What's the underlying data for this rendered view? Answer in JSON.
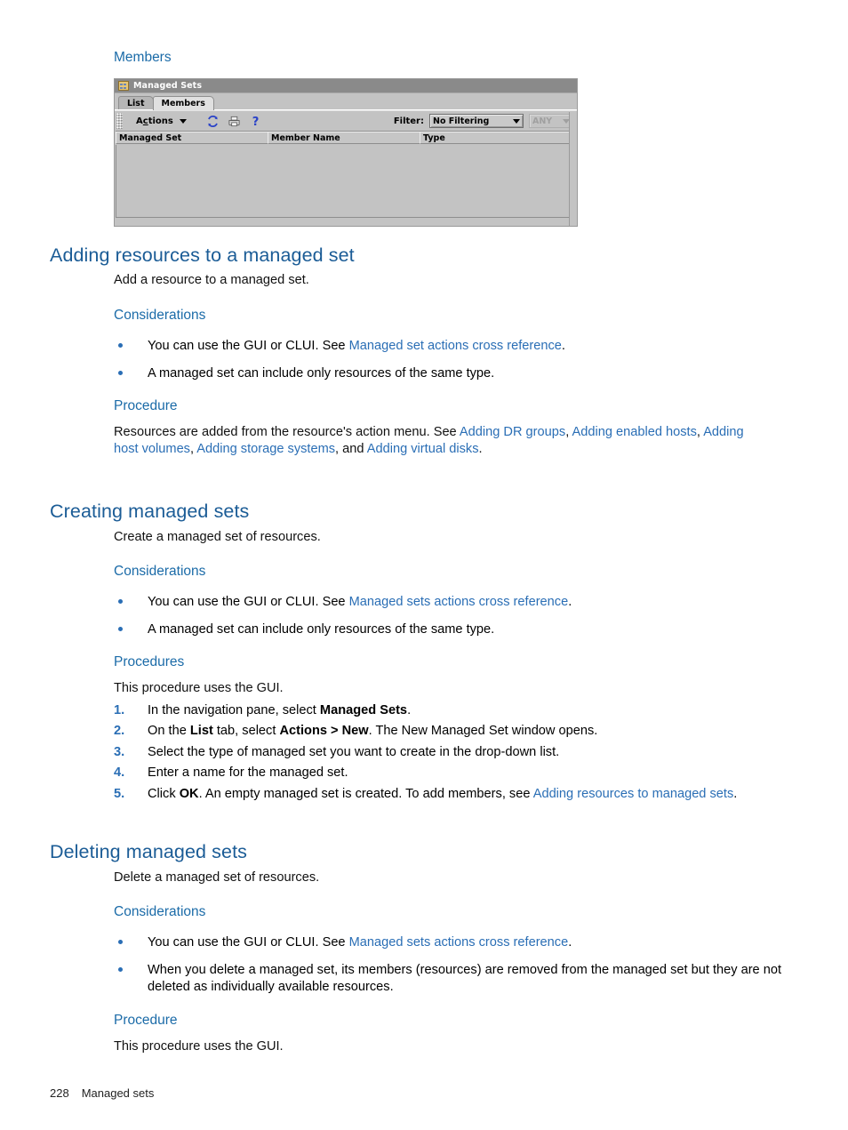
{
  "document": {
    "footer": {
      "page_number": "228",
      "section": "Managed sets"
    }
  },
  "sections": {
    "members_heading": "Members",
    "adding": {
      "title": "Adding resources to a managed set",
      "intro": "Add a resource to a managed set.",
      "considerations_heading": "Considerations",
      "bullet1_pre": "You can use the GUI or CLUI. See ",
      "bullet1_link": "Managed set actions cross reference",
      "bullet1_post": ".",
      "bullet2": "A managed set can include only resources of the same type.",
      "procedure_heading": "Procedure",
      "proc_pre": "Resources are added from the resource's action menu. See ",
      "proc_link1": "Adding DR groups",
      "proc_sep1": ", ",
      "proc_link2": "Adding enabled hosts",
      "proc_sep2": ", ",
      "proc_link3": "Adding host volumes",
      "proc_sep3": ", ",
      "proc_link4": "Adding storage systems",
      "proc_sep4": ", and ",
      "proc_link5": "Adding virtual disks",
      "proc_post": "."
    },
    "creating": {
      "title": "Creating managed sets",
      "intro": "Create a managed set of resources.",
      "considerations_heading": "Considerations",
      "bullet1_pre": "You can use the GUI or CLUI. See ",
      "bullet1_link": "Managed sets actions cross reference",
      "bullet1_post": ".",
      "bullet2": "A managed set can include only resources of the same type.",
      "procedures_heading": "Procedures",
      "procedures_intro": "This procedure uses the GUI.",
      "steps": [
        {
          "number": "1.",
          "pre": "In the navigation pane, select ",
          "bold": "Managed Sets",
          "post": "."
        },
        {
          "number": "2.",
          "pre": "On the ",
          "bold": "List",
          "mid": " tab, select ",
          "bold2": "Actions > New",
          "post": ". The New Managed Set window opens."
        },
        {
          "number": "3.",
          "pre": "Select the type of managed set you want to create in the drop-down list.",
          "bold": "",
          "post": ""
        },
        {
          "number": "4.",
          "pre": "Enter a name for the managed set.",
          "bold": "",
          "post": ""
        },
        {
          "number": "5.",
          "pre": "Click ",
          "bold": "OK",
          "post": ". An empty managed set is created. To add members, see ",
          "link": "Adding resources to managed sets",
          "tail": "."
        }
      ]
    },
    "deleting": {
      "title": "Deleting managed sets",
      "intro": "Delete a managed set of resources.",
      "considerations_heading": "Considerations",
      "bullet1_pre": "You can use the GUI or CLUI. See ",
      "bullet1_link": "Managed sets actions cross reference",
      "bullet1_post": ".",
      "bullet2": "When you delete a managed set, its members (resources) are removed from the managed set but they are not deleted as individually available resources.",
      "procedure_heading": "Procedure",
      "procedure_intro": "This procedure uses the GUI."
    }
  },
  "screenshot": {
    "window_title": "Managed Sets",
    "title_icon": "managed-sets-icon",
    "tabs": [
      {
        "label": "List",
        "active": false
      },
      {
        "label": "Members",
        "active": true
      }
    ],
    "toolbar": {
      "actions_label_a": "A",
      "actions_label_c": "c",
      "actions_label_rest": "tions",
      "icons": [
        {
          "name": "refresh-icon"
        },
        {
          "name": "print-icon"
        },
        {
          "name": "help-icon"
        }
      ],
      "filter_label": "Filter:",
      "filter_value": "No Filtering",
      "match_value": "ANY"
    },
    "table": {
      "columns": [
        "Managed Set",
        "Member Name",
        "Type"
      ],
      "rows": []
    }
  },
  "colors": {
    "heading_blue": "#1b5c96",
    "subheading_blue": "#1b6ba8",
    "link_blue": "#2a6eb5",
    "widget_face": "#c3c3c3",
    "titlebar": "#8a8a8a"
  }
}
